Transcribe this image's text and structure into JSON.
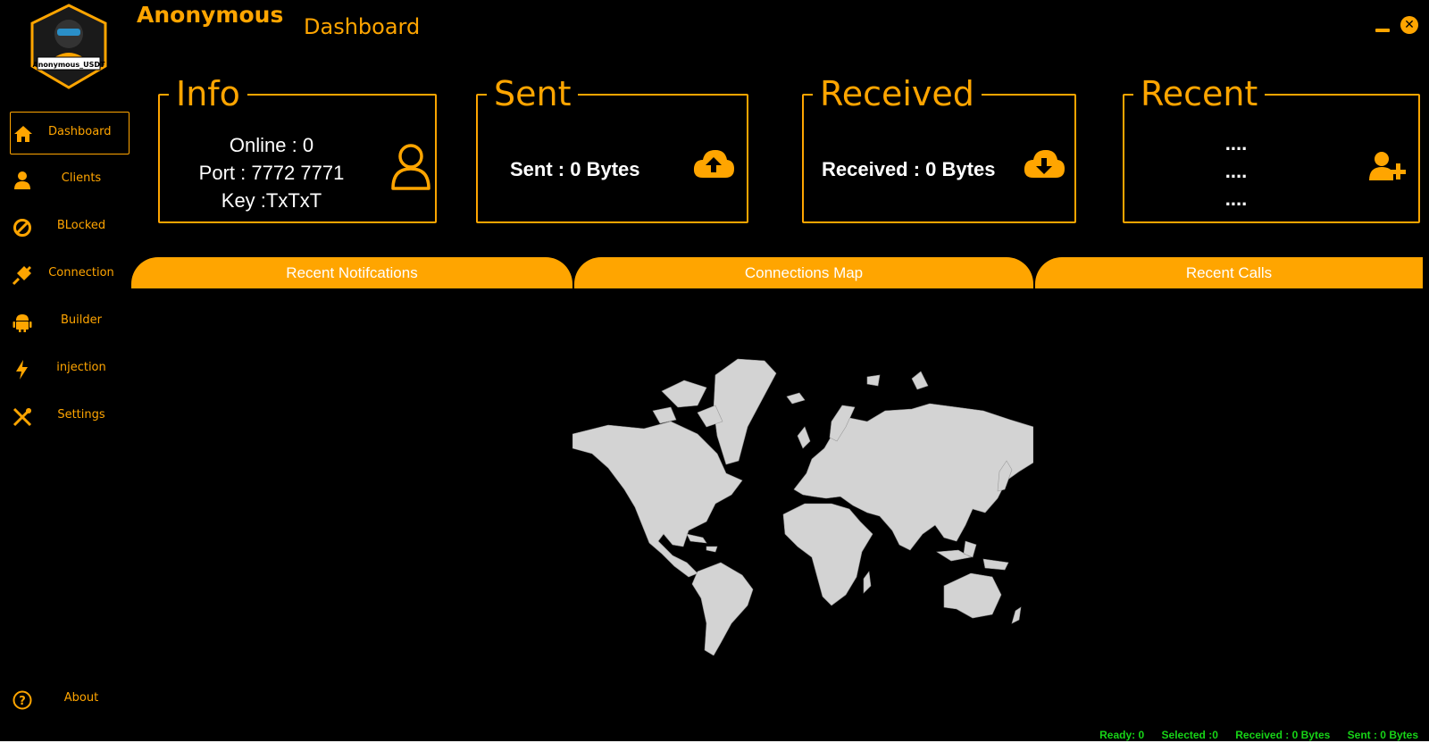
{
  "app": {
    "title": "Anonymous",
    "page_title": "Dashboard",
    "logo_text": "Anonymous_USDT"
  },
  "window": {
    "minimize_label": "",
    "close_label": "✕"
  },
  "sidebar": {
    "items": [
      {
        "label": "Dashboard",
        "icon": "home-icon"
      },
      {
        "label": "Clients",
        "icon": "user-icon"
      },
      {
        "label": "BLocked",
        "icon": "ban-icon"
      },
      {
        "label": "Connection",
        "icon": "plug-icon"
      },
      {
        "label": "Builder",
        "icon": "android-icon"
      },
      {
        "label": "injection",
        "icon": "bolt-icon"
      },
      {
        "label": "Settings",
        "icon": "tools-icon"
      }
    ],
    "about": {
      "label": "About",
      "icon": "question-icon"
    }
  },
  "cards": {
    "info": {
      "title": "Info",
      "online": "Online : 0",
      "port": "Port : 7772 7771",
      "key": "Key :TxTxT",
      "icon": "user-outline-icon"
    },
    "sent": {
      "title": "Sent",
      "value": "Sent : 0 Bytes",
      "icon": "cloud-upload-icon"
    },
    "received": {
      "title": "Received",
      "value": "Received : 0 Bytes",
      "icon": "cloud-download-icon"
    },
    "recent": {
      "title": "Recent",
      "lines": [
        "....",
        "....",
        "...."
      ],
      "icon": "user-plus-icon"
    }
  },
  "tabs": [
    {
      "label": "Recent Notifcations"
    },
    {
      "label": "Connections Map"
    },
    {
      "label": "Recent Calls"
    }
  ],
  "status": {
    "ready": "Ready: 0",
    "selected": "Selected :0",
    "received": "Received : 0 Bytes",
    "sent": "Sent : 0 Bytes"
  },
  "colors": {
    "accent": "#ffa500",
    "background": "#000000",
    "status_text": "#17d417",
    "map_land": "#d3d3d3"
  }
}
